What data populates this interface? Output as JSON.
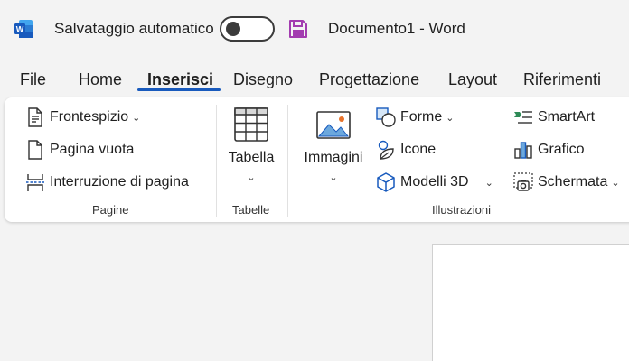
{
  "titlebar": {
    "autosave_label": "Salvataggio automatico",
    "autosave_on": false,
    "doc_title": "Documento1  -  Word"
  },
  "tabs": [
    {
      "label": "File"
    },
    {
      "label": "Home"
    },
    {
      "label": "Inserisci",
      "active": true
    },
    {
      "label": "Disegno"
    },
    {
      "label": "Progettazione"
    },
    {
      "label": "Layout"
    },
    {
      "label": "Riferimenti"
    }
  ],
  "ribbon": {
    "pagine": {
      "frontespizio": "Frontespizio",
      "pagina_vuota": "Pagina vuota",
      "interruzione": "Interruzione di pagina",
      "label": "Pagine"
    },
    "tabelle": {
      "tabella": "Tabella",
      "label": "Tabelle"
    },
    "illustrazioni": {
      "immagini": "Immagini",
      "forme": "Forme",
      "icone": "Icone",
      "modelli3d": "Modelli 3D",
      "smartart": "SmartArt",
      "grafico": "Grafico",
      "schermata": "Schermata",
      "label": "Illustrazioni"
    }
  },
  "colors": {
    "accent": "#185abd",
    "word_blue": "#185abd",
    "save_purple": "#a33cb0"
  }
}
